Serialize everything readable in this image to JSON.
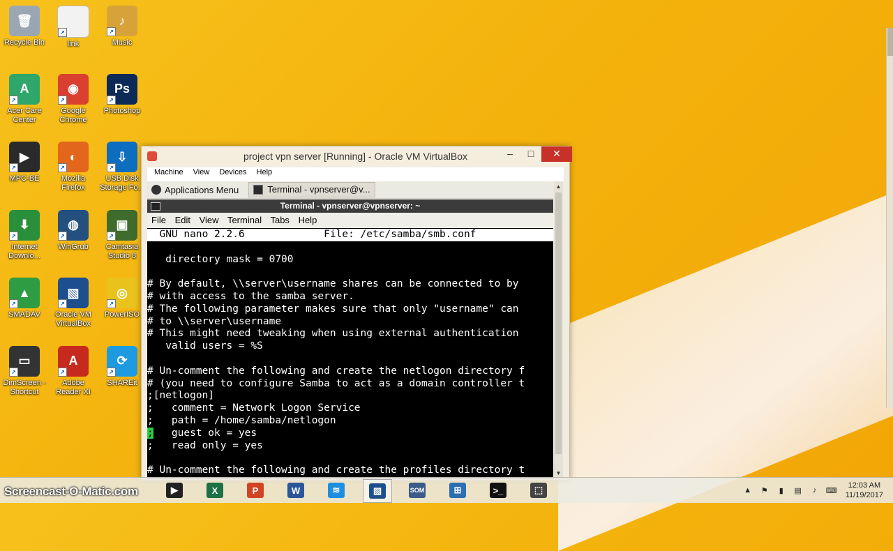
{
  "desktop": {
    "icons": [
      {
        "label": "Recycle Bin",
        "color": "#9aa7b3",
        "glyph": "🗑"
      },
      {
        "label": "link",
        "color": "#f2f2f2",
        "glyph": ""
      },
      {
        "label": "Music",
        "color": "#d8a23a",
        "glyph": "♪"
      },
      {
        "label": "Acer Care Center",
        "color": "#2fa66a",
        "glyph": "A"
      },
      {
        "label": "Google Chrome",
        "color": "#d9402f",
        "glyph": "◉"
      },
      {
        "label": "Photoshop",
        "color": "#0b2a57",
        "glyph": "Ps"
      },
      {
        "label": "MPC-BE",
        "color": "#2a2a2a",
        "glyph": "▶"
      },
      {
        "label": "Mozilla Firefox",
        "color": "#e2661c",
        "glyph": "◐"
      },
      {
        "label": "USB Disk Storage Fo...",
        "color": "#0d6ec0",
        "glyph": "⇩"
      },
      {
        "label": "Internet Downlo...",
        "color": "#2a8f3a",
        "glyph": "⬇"
      },
      {
        "label": "WinGrub",
        "color": "#23507f",
        "glyph": "◍"
      },
      {
        "label": "Camtasia Studio 8",
        "color": "#3f6b2c",
        "glyph": "▣"
      },
      {
        "label": "SMADAV",
        "color": "#2e9c42",
        "glyph": "▲"
      },
      {
        "label": "Oracle VM VirtualBox",
        "color": "#1d4f8f",
        "glyph": "▧"
      },
      {
        "label": "PowerISO",
        "color": "#e9c21c",
        "glyph": "◎"
      },
      {
        "label": "DimScreen - Shortcut",
        "color": "#333333",
        "glyph": "▭"
      },
      {
        "label": "Adobe Reader XI",
        "color": "#c62a1e",
        "glyph": "A"
      },
      {
        "label": "SHAREit",
        "color": "#1e9be0",
        "glyph": "⟳"
      }
    ]
  },
  "vbox": {
    "title": "project vpn server [Running] - Oracle VM VirtualBox",
    "menu": [
      "Machine",
      "View",
      "Devices",
      "Help"
    ],
    "min": "–",
    "max": "□",
    "close": "✕"
  },
  "guest": {
    "app_menu": "Applications Menu",
    "task": "Terminal - vpnserver@v..."
  },
  "terminal": {
    "title": "Terminal - vpnserver@vpnserver: ~",
    "menu": [
      "File",
      "Edit",
      "View",
      "Terminal",
      "Tabs",
      "Help"
    ],
    "header": "  GNU nano 2.2.6             File: /etc/samba/smb.conf                 ",
    "lines": [
      "",
      "   directory mask = 0700",
      "",
      "# By default, \\\\server\\username shares can be connected to by",
      "# with access to the samba server.",
      "# The following parameter makes sure that only \"username\" can",
      "# to \\\\server\\username",
      "# This might need tweaking when using external authentication",
      "   valid users = %S",
      "",
      "# Un-comment the following and create the netlogon directory f",
      "# (you need to configure Samba to act as a domain controller t",
      ";[netlogon]",
      ";   comment = Network Logon Service",
      ";   path = /home/samba/netlogon",
      "",
      ";   read only = yes",
      "",
      "# Un-comment the following and create the profiles directory t"
    ],
    "cursor_char": ";",
    "cursor_rest": "   guest ok = yes"
  },
  "taskbar": {
    "watermark": "Screencast-O-Matic.com",
    "apps": [
      {
        "name": "mpc-be",
        "label": "▶",
        "color": "#222222"
      },
      {
        "name": "excel",
        "label": "X",
        "color": "#1e7145"
      },
      {
        "name": "powerpoint",
        "label": "P",
        "color": "#d04423"
      },
      {
        "name": "word",
        "label": "W",
        "color": "#2b579a"
      },
      {
        "name": "wifi",
        "label": "≋",
        "color": "#1e8fe0"
      },
      {
        "name": "virtualbox",
        "label": "▧",
        "color": "#1d4f8f"
      },
      {
        "name": "som",
        "label": "SOM",
        "color": "#3a5b8a"
      },
      {
        "name": "network",
        "label": "⊞",
        "color": "#2c6fb2"
      },
      {
        "name": "cmd",
        "label": ">_",
        "color": "#111111"
      },
      {
        "name": "snip",
        "label": "⬚",
        "color": "#444444"
      }
    ],
    "clock_time": "12:03 AM",
    "clock_date": "11/19/2017"
  }
}
